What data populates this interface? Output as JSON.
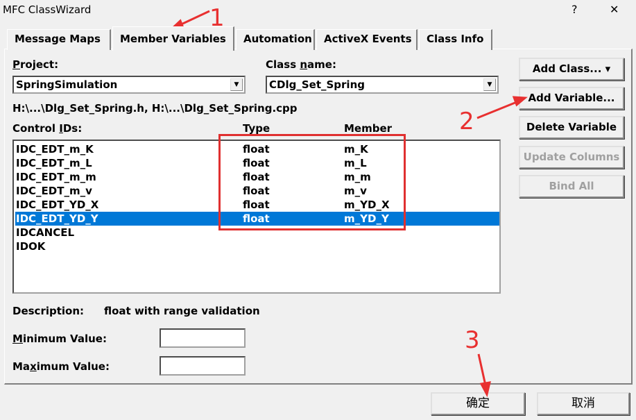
{
  "window": {
    "title": "MFC ClassWizard",
    "help": "?",
    "close": "✕"
  },
  "tabs": [
    {
      "label": "Message Maps"
    },
    {
      "label": "Member Variables",
      "active": true
    },
    {
      "label": "Automation"
    },
    {
      "label": "ActiveX Events"
    },
    {
      "label": "Class Info"
    }
  ],
  "project": {
    "label_u": "P",
    "label_rest": "roject:",
    "value": "SpringSimulation"
  },
  "class_name": {
    "label_pre": "Class ",
    "label_u": "n",
    "label_rest": "ame:",
    "value": "CDlg_Set_Spring"
  },
  "files": "H:\\...\\Dlg_Set_Spring.h, H:\\...\\Dlg_Set_Spring.cpp",
  "columns": {
    "ids_pre": "Control ",
    "ids_u": "I",
    "ids_rest": "Ds:",
    "type": "Type",
    "member": "Member"
  },
  "rows": [
    {
      "id": "IDC_EDT_m_K",
      "type": "float",
      "member": "m_K"
    },
    {
      "id": "IDC_EDT_m_L",
      "type": "float",
      "member": "m_L"
    },
    {
      "id": "IDC_EDT_m_m",
      "type": "float",
      "member": "m_m"
    },
    {
      "id": "IDC_EDT_m_v",
      "type": "float",
      "member": "m_v"
    },
    {
      "id": "IDC_EDT_YD_X",
      "type": "float",
      "member": "m_YD_X"
    },
    {
      "id": "IDC_EDT_YD_Y",
      "type": "float",
      "member": "m_YD_Y",
      "selected": true
    },
    {
      "id": "IDCANCEL",
      "type": "",
      "member": ""
    },
    {
      "id": "IDOK",
      "type": "",
      "member": ""
    }
  ],
  "buttons": {
    "add_class": "Add Class...  ▾",
    "add_variable": "Add Variable...",
    "delete_variable": "Delete Variable",
    "update_columns": "Update Columns",
    "bind_all": "Bind All",
    "ok": "确定",
    "cancel": "取消"
  },
  "description": {
    "label": "Description:",
    "value": "float with range validation"
  },
  "min": {
    "label_u": "M",
    "label_rest": "inimum Value:",
    "value": ""
  },
  "max": {
    "label_pre": "Ma",
    "label_u": "x",
    "label_rest": "imum Value:",
    "value": ""
  },
  "annotations": [
    "1",
    "2",
    "3"
  ],
  "colors": {
    "selection": "#0078d7",
    "annotation": "#e03030"
  }
}
